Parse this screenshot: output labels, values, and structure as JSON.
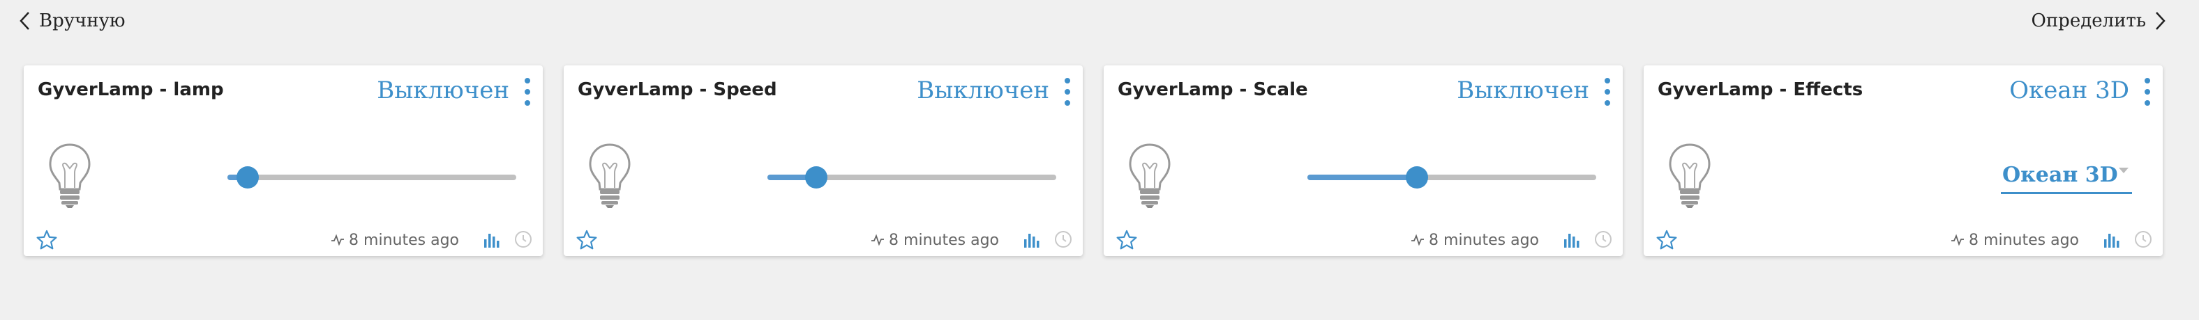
{
  "nav": {
    "back_label": "Вручную",
    "forward_label": "Определить"
  },
  "colors": {
    "accent": "#3d8fca",
    "track": "#c0c0c0",
    "background": "#f0f0f0"
  },
  "cards": [
    {
      "title": "GyverLamp - lamp",
      "state": "Выключен",
      "control": "slider",
      "slider_fraction": 0.07,
      "updated": "8 minutes ago"
    },
    {
      "title": "GyverLamp - Speed",
      "state": "Выключен",
      "control": "slider",
      "slider_fraction": 0.17,
      "updated": "8 minutes ago"
    },
    {
      "title": "GyverLamp - Scale",
      "state": "Выключен",
      "control": "slider",
      "slider_fraction": 0.38,
      "updated": "8 minutes ago"
    },
    {
      "title": "GyverLamp - Effects",
      "state": "Океан 3D",
      "control": "select",
      "selected": "Океан 3D",
      "updated": "8 minutes ago"
    }
  ],
  "icons": {
    "back": "chevron-left-icon",
    "forward": "chevron-right-icon",
    "menu": "kebab-menu-icon",
    "device": "light-bulb-icon",
    "favorite": "star-outline-icon",
    "activity": "pulse-icon",
    "chart": "bar-chart-icon",
    "history": "history-icon"
  }
}
